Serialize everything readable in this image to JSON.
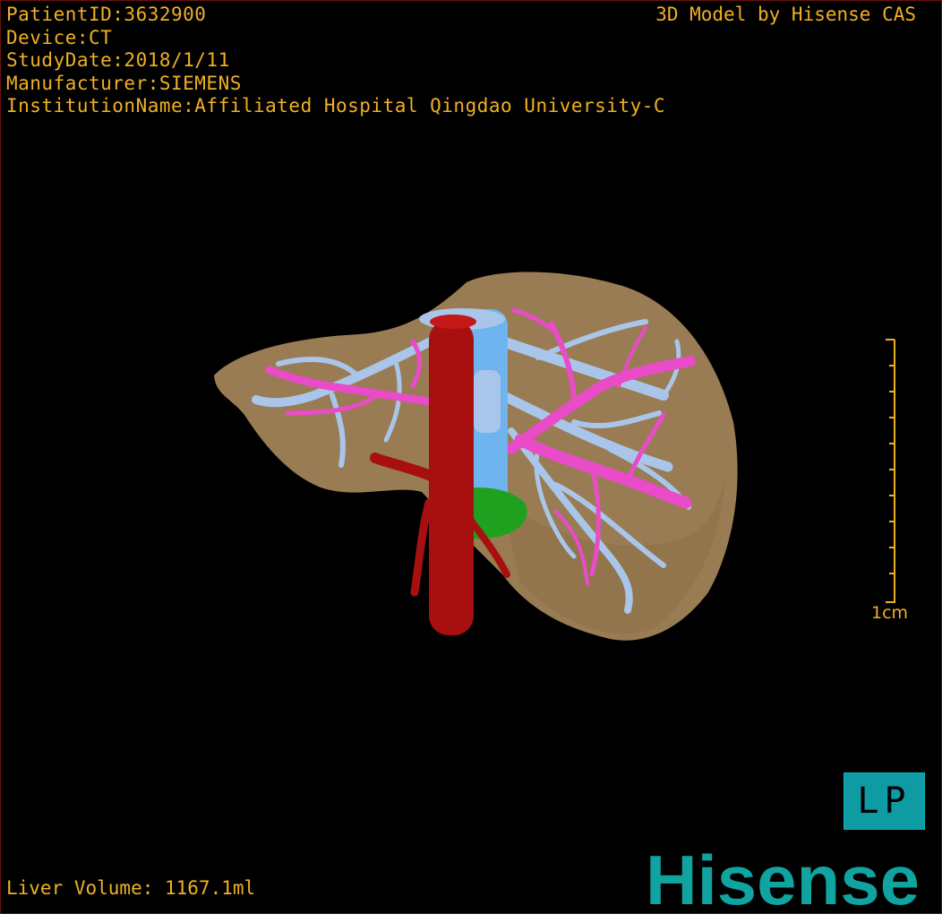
{
  "patient_info": {
    "patient_id": "PatientID:3632900",
    "device": "Device:CT",
    "study_date": "StudyDate:2018/1/11",
    "manufacturer": "Manufacturer:SIEMENS",
    "institution": "InstitutionName:Affiliated Hospital Qingdao University-C"
  },
  "model_credit": "3D Model by Hisense CAS",
  "scale": {
    "label": "1cm"
  },
  "orientation": "LP",
  "liver_volume": "Liver Volume: 1167.1ml",
  "brand": "Hisense",
  "colors": {
    "overlay_text": "#f0b024",
    "liver": "#a6875a",
    "hepatic_vein": "#a9c6ea",
    "ivc": "#6fb4ee",
    "portal_vein": "#ea4bc8",
    "artery": "#a81010",
    "gallbladder": "#1fa11f",
    "badge": "#0f9ba4",
    "logo": "#10a3a0"
  }
}
